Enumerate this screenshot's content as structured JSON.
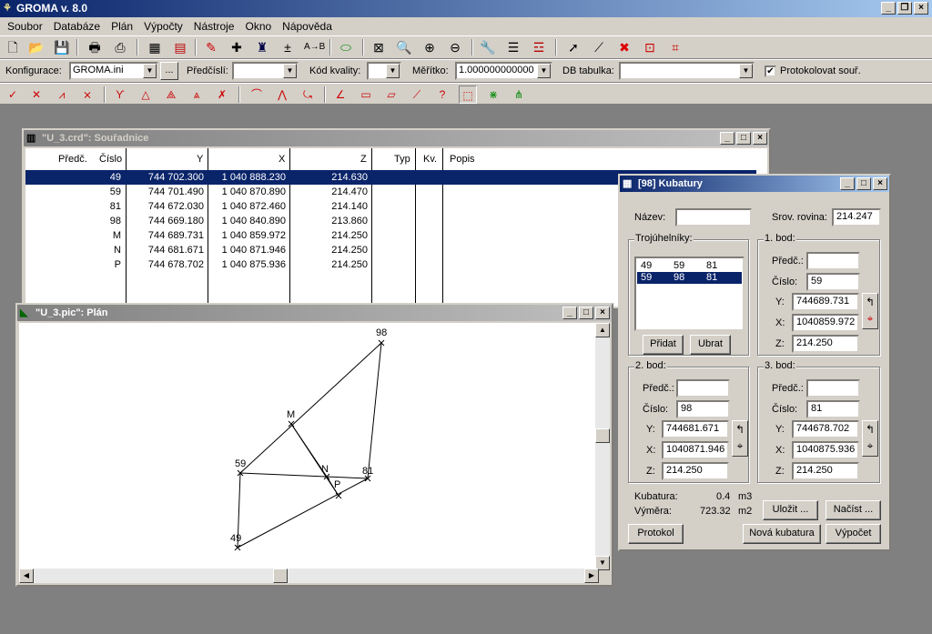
{
  "app": {
    "title": "GROMA v. 8.0"
  },
  "menu": [
    "Soubor",
    "Databáze",
    "Plán",
    "Výpočty",
    "Nástroje",
    "Okno",
    "Nápověda"
  ],
  "toolbar2": {
    "konfigurace_label": "Konfigurace:",
    "konfigurace_value": "GROMA.ini",
    "browse_label": "...",
    "predcisli_label": "Předčíslí:",
    "predcisli_value": "",
    "kod_kvality_label": "Kód kvality:",
    "kod_kvality_value": "",
    "meritko_label": "Měřítko:",
    "meritko_value": "1.000000000000",
    "db_tabulka_label": "DB tabulka:",
    "db_tabulka_value": "",
    "protokolovat_label": "Protokolovat souř.",
    "protokolovat_checked": true
  },
  "coord_window": {
    "title": "\"U_3.crd\": Souřadnice",
    "columns": [
      "Předč.",
      "Číslo",
      "Y",
      "X",
      "Z",
      "Typ",
      "Kv.",
      "Popis"
    ],
    "rows": [
      {
        "predc": "",
        "cislo": "49",
        "y": "744 702.300",
        "x": "1 040 888.230",
        "z": "214.630",
        "typ": "",
        "kv": "",
        "popis": ""
      },
      {
        "predc": "",
        "cislo": "59",
        "y": "744 701.490",
        "x": "1 040 870.890",
        "z": "214.470",
        "typ": "",
        "kv": "",
        "popis": ""
      },
      {
        "predc": "",
        "cislo": "81",
        "y": "744 672.030",
        "x": "1 040 872.460",
        "z": "214.140",
        "typ": "",
        "kv": "",
        "popis": ""
      },
      {
        "predc": "",
        "cislo": "98",
        "y": "744 669.180",
        "x": "1 040 840.890",
        "z": "213.860",
        "typ": "",
        "kv": "",
        "popis": ""
      },
      {
        "predc": "",
        "cislo": "M",
        "y": "744 689.731",
        "x": "1 040 859.972",
        "z": "214.250",
        "typ": "",
        "kv": "",
        "popis": ""
      },
      {
        "predc": "",
        "cislo": "N",
        "y": "744 681.671",
        "x": "1 040 871.946",
        "z": "214.250",
        "typ": "",
        "kv": "",
        "popis": ""
      },
      {
        "predc": "",
        "cislo": "P",
        "y": "744 678.702",
        "x": "1 040 875.936",
        "z": "214.250",
        "typ": "",
        "kv": "",
        "popis": ""
      }
    ],
    "selected_row": 0
  },
  "plan_window": {
    "title": "\"U_3.pic\": Plán",
    "point_labels": [
      "98",
      "M",
      "59",
      "N",
      "P",
      "81",
      "49"
    ]
  },
  "kub_window": {
    "title": "[98] Kubatury",
    "nazev_label": "Název:",
    "nazev_value": "",
    "srov_label": "Srov. rovina:",
    "srov_value": "214.247",
    "troj_title": "Trojúhelníky:",
    "triangles": [
      [
        "49",
        "59",
        "81"
      ],
      [
        "59",
        "98",
        "81"
      ]
    ],
    "selected_triangle": 1,
    "pridat": "Přidat",
    "ubrat": "Ubrat",
    "bod1": {
      "title": "1. bod:",
      "predc_label": "Předč.:",
      "predc": "",
      "cislo_label": "Číslo:",
      "cislo": "59",
      "y_label": "Y:",
      "y": "744689.731",
      "x_label": "X:",
      "x": "1040859.972",
      "z_label": "Z:",
      "z": "214.250"
    },
    "bod2": {
      "title": "2. bod:",
      "predc_label": "Předč.:",
      "predc": "",
      "cislo_label": "Číslo:",
      "cislo": "98",
      "y_label": "Y:",
      "y": "744681.671",
      "x_label": "X:",
      "x": "1040871.946",
      "z_label": "Z:",
      "z": "214.250"
    },
    "bod3": {
      "title": "3. bod:",
      "predc_label": "Předč.:",
      "predc": "",
      "cislo_label": "Číslo:",
      "cislo": "81",
      "y_label": "Y:",
      "y": "744678.702",
      "x_label": "X:",
      "x": "1040875.936",
      "z_label": "Z:",
      "z": "214.250"
    },
    "kubatura_label": "Kubatura:",
    "kubatura_value": "0.4",
    "kubatura_unit": "m3",
    "vymera_label": "Výměra:",
    "vymera_value": "723.32",
    "vymera_unit": "m2",
    "ulozit": "Uložit ...",
    "nacist": "Načíst ...",
    "protokol": "Protokol",
    "nova_kubatura": "Nová kubatura",
    "vypocet": "Výpočet"
  }
}
